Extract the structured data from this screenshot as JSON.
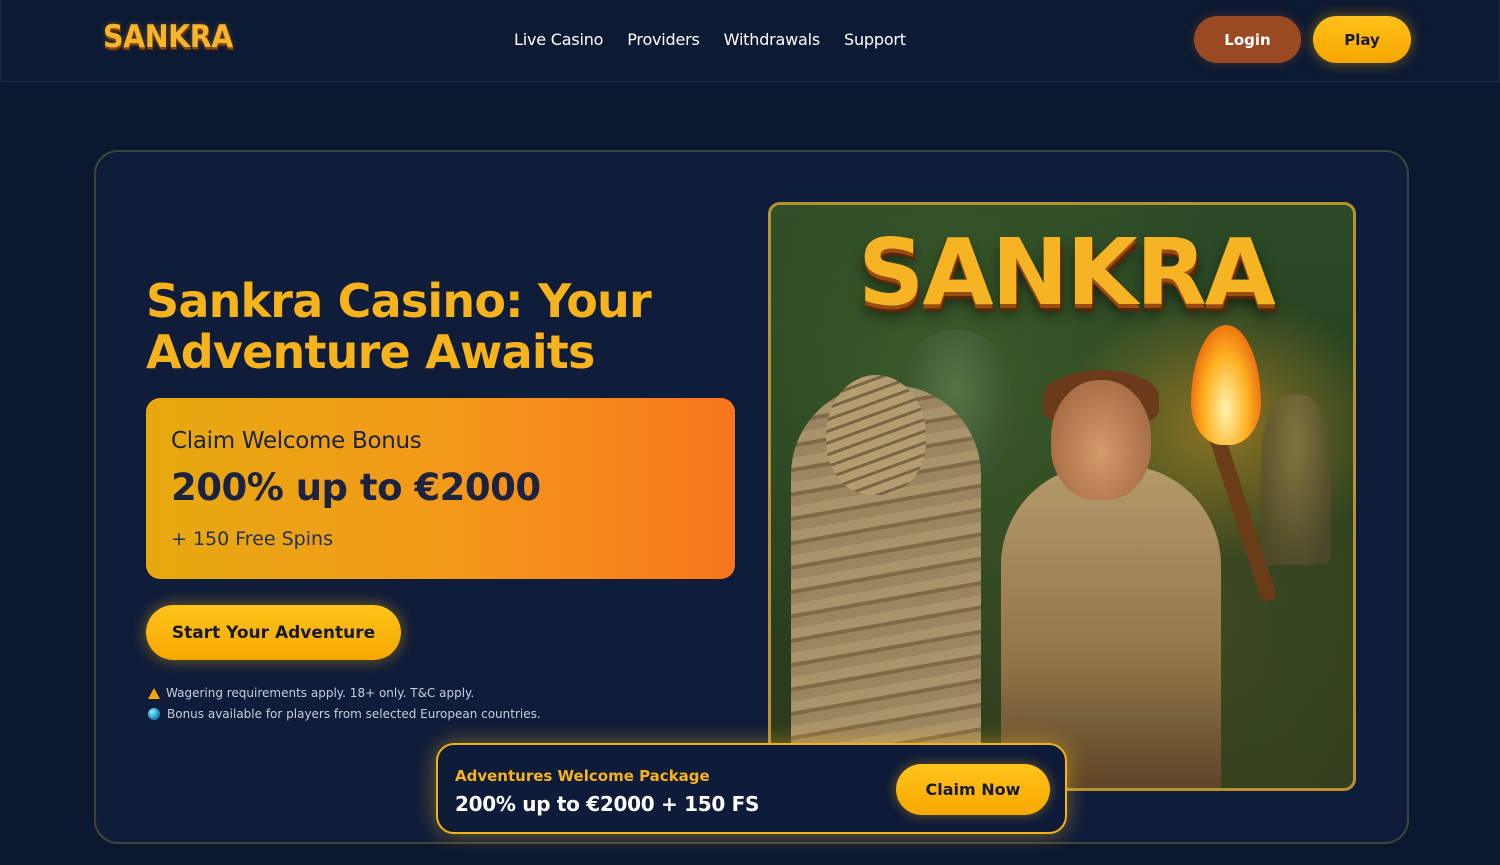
{
  "header": {
    "logo": "SANKRA",
    "nav": [
      "Live Casino",
      "Providers",
      "Withdrawals",
      "Support"
    ],
    "login_label": "Login",
    "play_label": "Play"
  },
  "hero": {
    "title": "Sankra Casino: Your Adventure Awaits",
    "bonus_label": "Claim Welcome Bonus",
    "bonus_amount": "200% up to €2000",
    "bonus_spins": "+ 150 Free Spins",
    "cta_label": "Start Your Adventure",
    "notes": [
      {
        "icon": "warning-icon",
        "text": "Wagering requirements apply. 18+ only. T&C apply."
      },
      {
        "icon": "globe-icon",
        "text": "Bonus available for players from selected European countries."
      }
    ],
    "art_title": "SANKRA"
  },
  "promo": {
    "kicker": "Adventures Welcome Package",
    "offer": "200% up to €2000 + 150 FS",
    "cta_label": "Claim Now"
  },
  "colors": {
    "background": "#0c1730",
    "accent_gold": "#f7b31b",
    "login_brown": "#9a4a22",
    "bonus_gradient_start": "#e7a90f",
    "bonus_gradient_end": "#f8761e"
  }
}
